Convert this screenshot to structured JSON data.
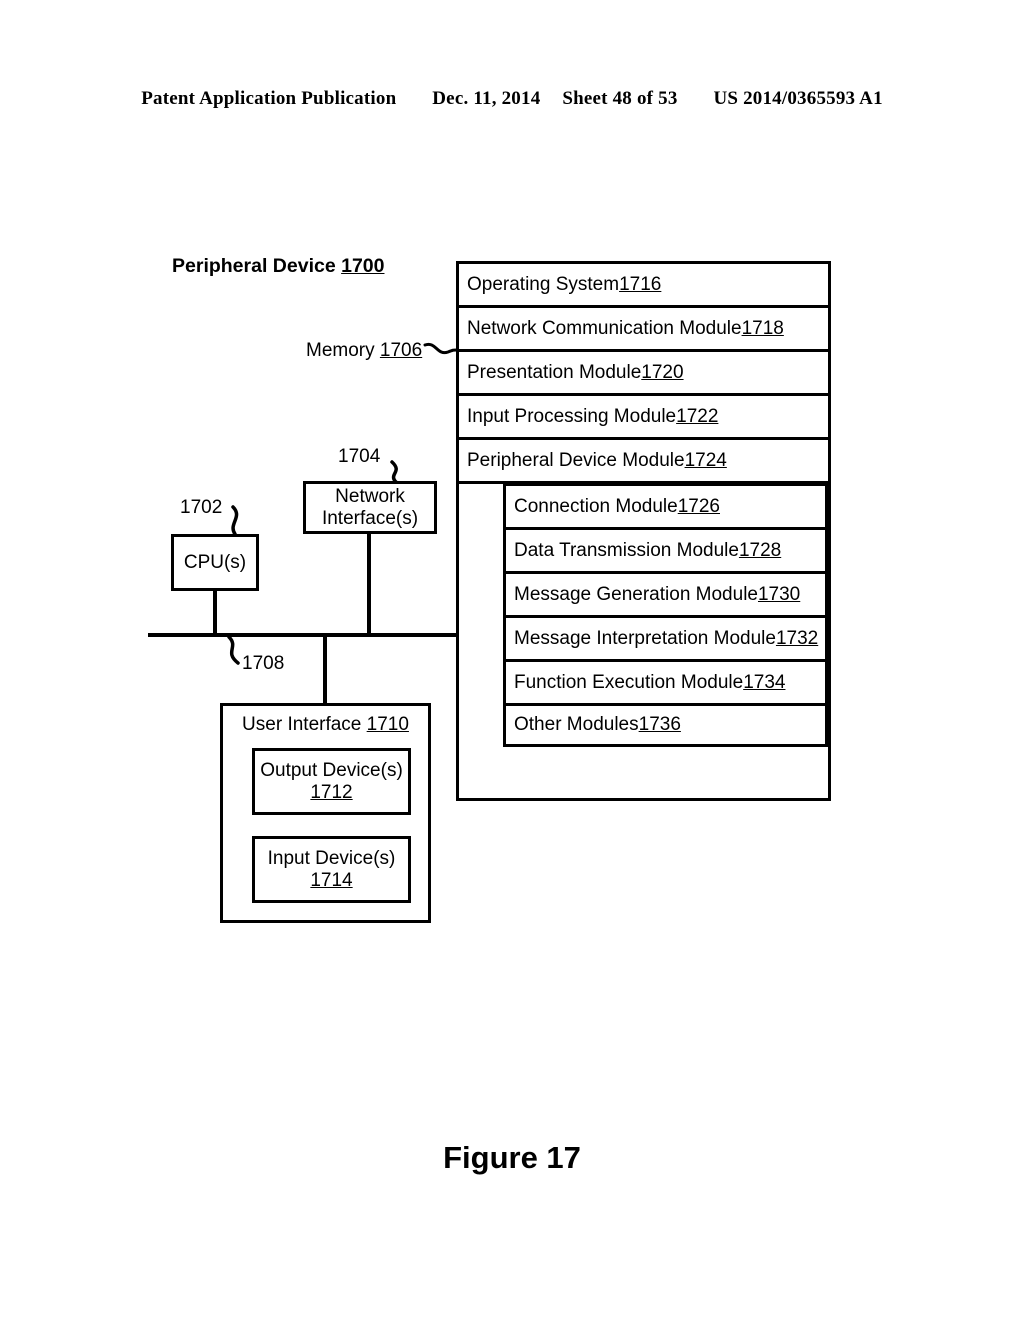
{
  "header": {
    "publication": "Patent Application Publication",
    "date": "Dec. 11, 2014",
    "sheet": "Sheet 48 of 53",
    "number": "US 2014/0365593 A1"
  },
  "figure": {
    "caption": "Figure 17"
  },
  "diagram": {
    "title_text": "Peripheral Device ",
    "title_ref": "1700",
    "memory": {
      "label_text": "Memory ",
      "label_ref": "1706",
      "rows": [
        {
          "text": "Operating System ",
          "ref": "1716"
        },
        {
          "text": "Network Communication Module ",
          "ref": "1718"
        },
        {
          "text": "Presentation Module ",
          "ref": "1720"
        },
        {
          "text": "Input Processing Module ",
          "ref": "1722"
        },
        {
          "text": "Peripheral Device Module ",
          "ref": "1724"
        }
      ],
      "submodules": [
        {
          "text": "Connection Module ",
          "ref": "1726"
        },
        {
          "text": "Data Transmission Module ",
          "ref": "1728"
        },
        {
          "text": "Message Generation Module ",
          "ref": "1730"
        },
        {
          "text": "Message Interpretation Module ",
          "ref": "1732"
        },
        {
          "text": "Function Execution Module ",
          "ref": "1734"
        },
        {
          "text": "Other Modules ",
          "ref": "1736"
        }
      ]
    },
    "cpu": {
      "label": "CPU(s)",
      "ref": "1702"
    },
    "network_interface": {
      "line1": "Network",
      "line2": "Interface(s)",
      "ref": "1704"
    },
    "bus": {
      "ref": "1708"
    },
    "user_interface": {
      "label_text": "User Interface ",
      "label_ref": "1710",
      "output_device": {
        "line1": "Output Device(s)",
        "ref": "1712"
      },
      "input_device": {
        "line1": "Input Device(s)",
        "ref": "1714"
      }
    }
  },
  "colors": {
    "ink": "#000000",
    "paper": "#ffffff"
  }
}
